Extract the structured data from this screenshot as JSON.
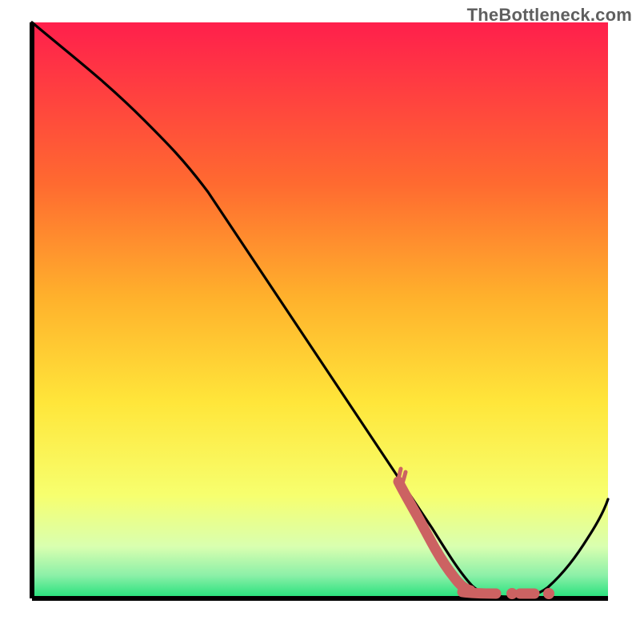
{
  "watermark": "TheBottleneck.com",
  "colors": {
    "gradient_top": "#ff1f4c",
    "gradient_mid1": "#ff8a2a",
    "gradient_mid2": "#ffe63a",
    "gradient_mid3": "#f5ff7a",
    "gradient_bottom": "#21e07a",
    "axis": "#000000",
    "curve": "#000000",
    "scribble": "#cc6262"
  },
  "chart_data": {
    "type": "line",
    "title": "",
    "xlabel": "",
    "ylabel": "",
    "xlim": [
      0,
      100
    ],
    "ylim": [
      0,
      100
    ],
    "grid": false,
    "series": [
      {
        "name": "bottleneck-curve",
        "x": [
          0,
          5,
          12,
          20,
          30,
          40,
          50,
          60,
          68,
          74,
          78,
          82,
          86,
          90,
          94,
          98,
          100
        ],
        "y": [
          100,
          95,
          90,
          82,
          70,
          56,
          42,
          28,
          17,
          9,
          4,
          1,
          1,
          4,
          10,
          17,
          20
        ]
      }
    ],
    "annotations": [
      {
        "name": "scribble-L-mark",
        "approx_x_range": [
          60,
          86
        ],
        "approx_y_range": [
          0,
          12
        ],
        "description": "Hand-drawn pink 'L.' style scribble marking the low region of the curve"
      }
    ]
  }
}
